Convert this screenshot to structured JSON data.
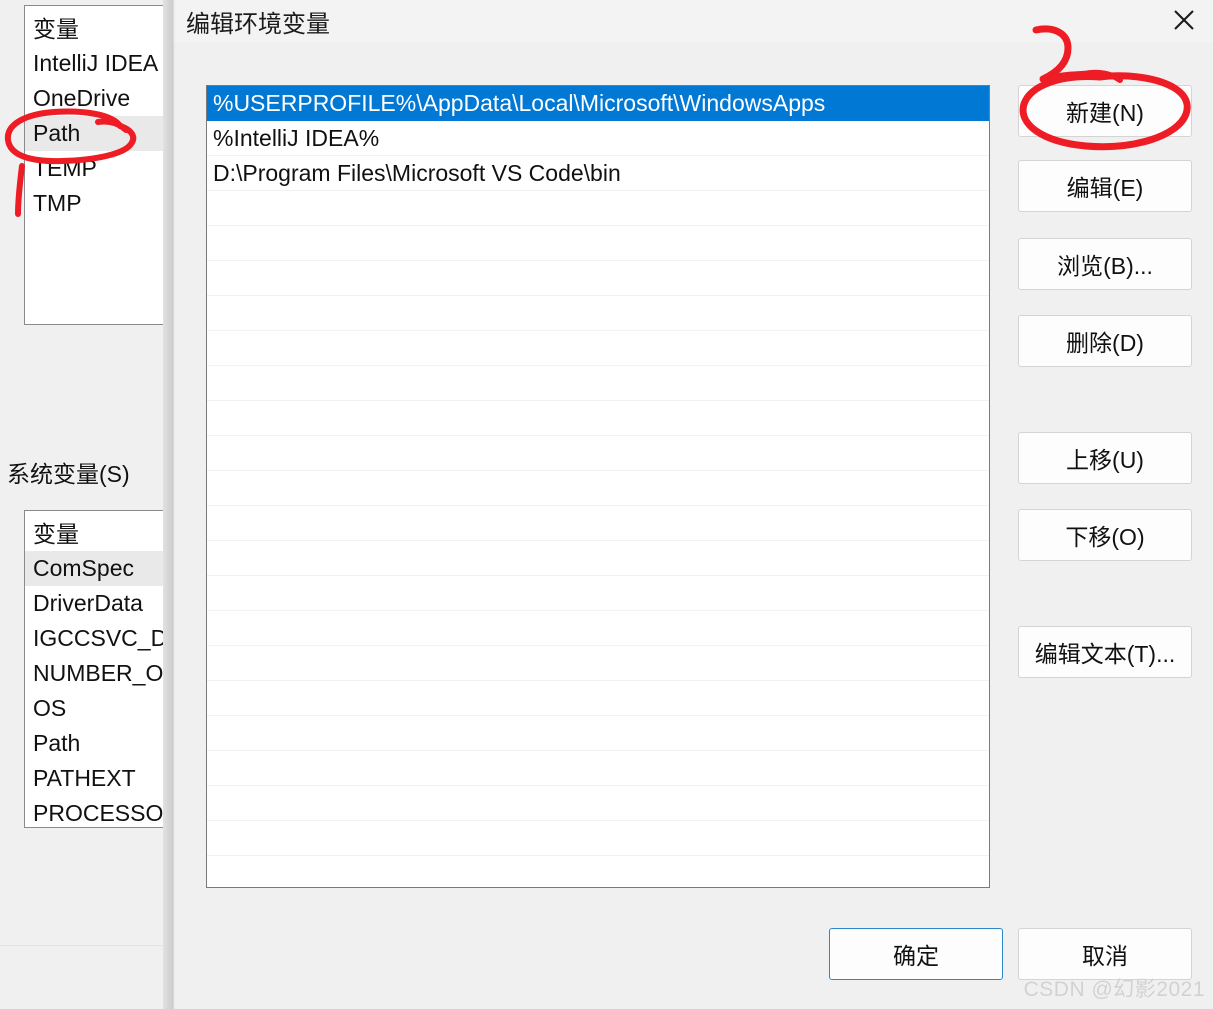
{
  "background_window": {
    "user_variables_list": {
      "header": "变量",
      "items": [
        {
          "name": "IntelliJ IDEA",
          "selected": false
        },
        {
          "name": "OneDrive",
          "selected": false
        },
        {
          "name": "Path",
          "selected": true
        },
        {
          "name": "TEMP",
          "selected": false
        },
        {
          "name": "TMP",
          "selected": false
        }
      ]
    },
    "system_variables_label": "系统变量(S)",
    "system_variables_list": {
      "header": "变量",
      "items": [
        {
          "name": "ComSpec",
          "selected": true
        },
        {
          "name": "DriverData",
          "selected": false
        },
        {
          "name": "IGCCSVC_DE",
          "selected": false
        },
        {
          "name": "NUMBER_OI",
          "selected": false
        },
        {
          "name": "OS",
          "selected": false
        },
        {
          "name": "Path",
          "selected": false
        },
        {
          "name": "PATHEXT",
          "selected": false
        },
        {
          "name": "PROCESSOR",
          "selected": false
        }
      ]
    }
  },
  "dialog": {
    "title": "编辑环境变量",
    "close_icon": "close-icon",
    "path_entries": [
      {
        "value": "%USERPROFILE%\\AppData\\Local\\Microsoft\\WindowsApps",
        "selected": true
      },
      {
        "value": "%IntelliJ IDEA%",
        "selected": false
      },
      {
        "value": "D:\\Program Files\\Microsoft VS Code\\bin",
        "selected": false
      },
      {
        "value": "",
        "selected": false
      },
      {
        "value": "",
        "selected": false
      },
      {
        "value": "",
        "selected": false
      },
      {
        "value": "",
        "selected": false
      },
      {
        "value": "",
        "selected": false
      },
      {
        "value": "",
        "selected": false
      },
      {
        "value": "",
        "selected": false
      },
      {
        "value": "",
        "selected": false
      },
      {
        "value": "",
        "selected": false
      },
      {
        "value": "",
        "selected": false
      },
      {
        "value": "",
        "selected": false
      },
      {
        "value": "",
        "selected": false
      },
      {
        "value": "",
        "selected": false
      },
      {
        "value": "",
        "selected": false
      },
      {
        "value": "",
        "selected": false
      },
      {
        "value": "",
        "selected": false
      },
      {
        "value": "",
        "selected": false
      },
      {
        "value": "",
        "selected": false
      },
      {
        "value": "",
        "selected": false
      },
      {
        "value": "",
        "selected": false
      }
    ],
    "buttons": {
      "new": "新建(N)",
      "edit": "编辑(E)",
      "browse": "浏览(B)...",
      "delete": "删除(D)",
      "move_up": "上移(U)",
      "move_down": "下移(O)",
      "edit_text": "编辑文本(T)...",
      "ok": "确定",
      "cancel": "取消"
    }
  },
  "annotations": {
    "circle_path": "red-ellipse-around-path",
    "circle_new_button": "red-ellipse-around-new-button",
    "arrow_to_new_button": "red-arrow"
  },
  "watermark": "CSDN @幻影2021",
  "colors": {
    "selection_blue": "#0078d4",
    "annotation_red": "#ee1c24",
    "ok_button_border": "#2b88c8",
    "dialog_background": "#f0f0f0"
  }
}
